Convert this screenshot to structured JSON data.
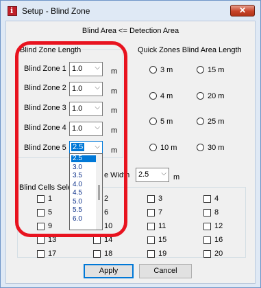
{
  "window": {
    "title": "Setup - Blind Zone",
    "close_glyph": "✕"
  },
  "caption": "Blind Area <= Detection Area",
  "blind_zone_length": {
    "title": "Blind Zone Length",
    "unit": "m",
    "zones": [
      {
        "label": "Blind Zone 1",
        "value": "1.0"
      },
      {
        "label": "Blind Zone 2",
        "value": "1.0"
      },
      {
        "label": "Blind Zone 3",
        "value": "1.0"
      },
      {
        "label": "Blind Zone 4",
        "value": "1.0"
      },
      {
        "label": "Blind Zone 5",
        "value": "2.5"
      }
    ]
  },
  "quick_zones": {
    "title": "Quick Zones Blind Area Length",
    "options": [
      "3 m",
      "15 m",
      "4 m",
      "20 m",
      "5 m",
      "25 m",
      "10 m",
      "30 m"
    ]
  },
  "width": {
    "label_visible": "e Width",
    "value": "2.5",
    "unit": "m"
  },
  "blind_cells": {
    "title_visible": "Blind Cells Sele",
    "cells": [
      "1",
      "2",
      "3",
      "4",
      "5",
      "6",
      "7",
      "8",
      "9",
      "10",
      "11",
      "12",
      "13",
      "14",
      "15",
      "16",
      "17",
      "18",
      "19",
      "20"
    ]
  },
  "dropdown": {
    "options": [
      "2.5",
      "3.0",
      "3.5",
      "4.0",
      "4.5",
      "5.0",
      "5.5",
      "6.0"
    ],
    "selected": "2.5"
  },
  "buttons": {
    "apply": "Apply",
    "cancel": "Cancel"
  },
  "colors": {
    "annotation_outline": "#e8131f",
    "accent": "#0078d7",
    "close_button": "#c8442a"
  },
  "icons": {
    "chevron": "⌵"
  }
}
